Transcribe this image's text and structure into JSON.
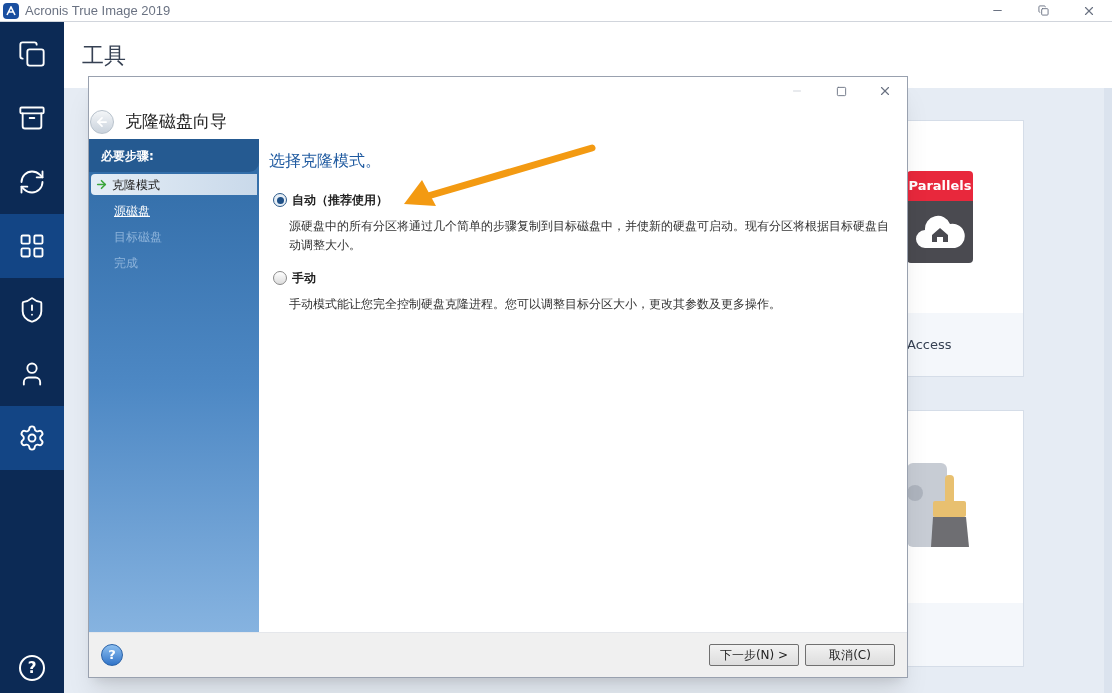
{
  "window": {
    "title": "Acronis True Image 2019"
  },
  "sidebar": {
    "items": [
      {
        "selected": false
      },
      {
        "selected": false
      },
      {
        "selected": false
      },
      {
        "selected": true
      },
      {
        "selected": false
      },
      {
        "selected": false
      },
      {
        "selected": true
      }
    ],
    "help_icon": "?"
  },
  "page": {
    "title": "工具"
  },
  "background_cards": [
    {
      "kind": "parallels",
      "logo_text": "Parallels",
      "label": "Access"
    },
    {
      "kind": "cleanup"
    }
  ],
  "dialog": {
    "title": "克隆磁盘向导",
    "steps_header": "必要步骤:",
    "help_icon": "?",
    "steps": [
      {
        "label": "克隆模式",
        "kind": "current"
      },
      {
        "label": "源磁盘",
        "kind": "link"
      },
      {
        "label": "目标磁盘",
        "kind": "disabled"
      },
      {
        "label": "完成",
        "kind": "disabled"
      }
    ],
    "heading": "选择克隆模式。",
    "options": [
      {
        "label": "自动（推荐使用）",
        "description": "源硬盘中的所有分区将通过几个简单的步骤复制到目标磁盘中，并使新的硬盘可启动。现有分区将根据目标硬盘自动调整大小。",
        "selected": true
      },
      {
        "label": "手动",
        "description": "手动模式能让您完全控制硬盘克隆进程。您可以调整目标分区大小，更改其参数及更多操作。",
        "selected": false
      }
    ],
    "buttons": [
      {
        "label": "下一步(N) >"
      },
      {
        "label": "取消(C)"
      }
    ]
  }
}
